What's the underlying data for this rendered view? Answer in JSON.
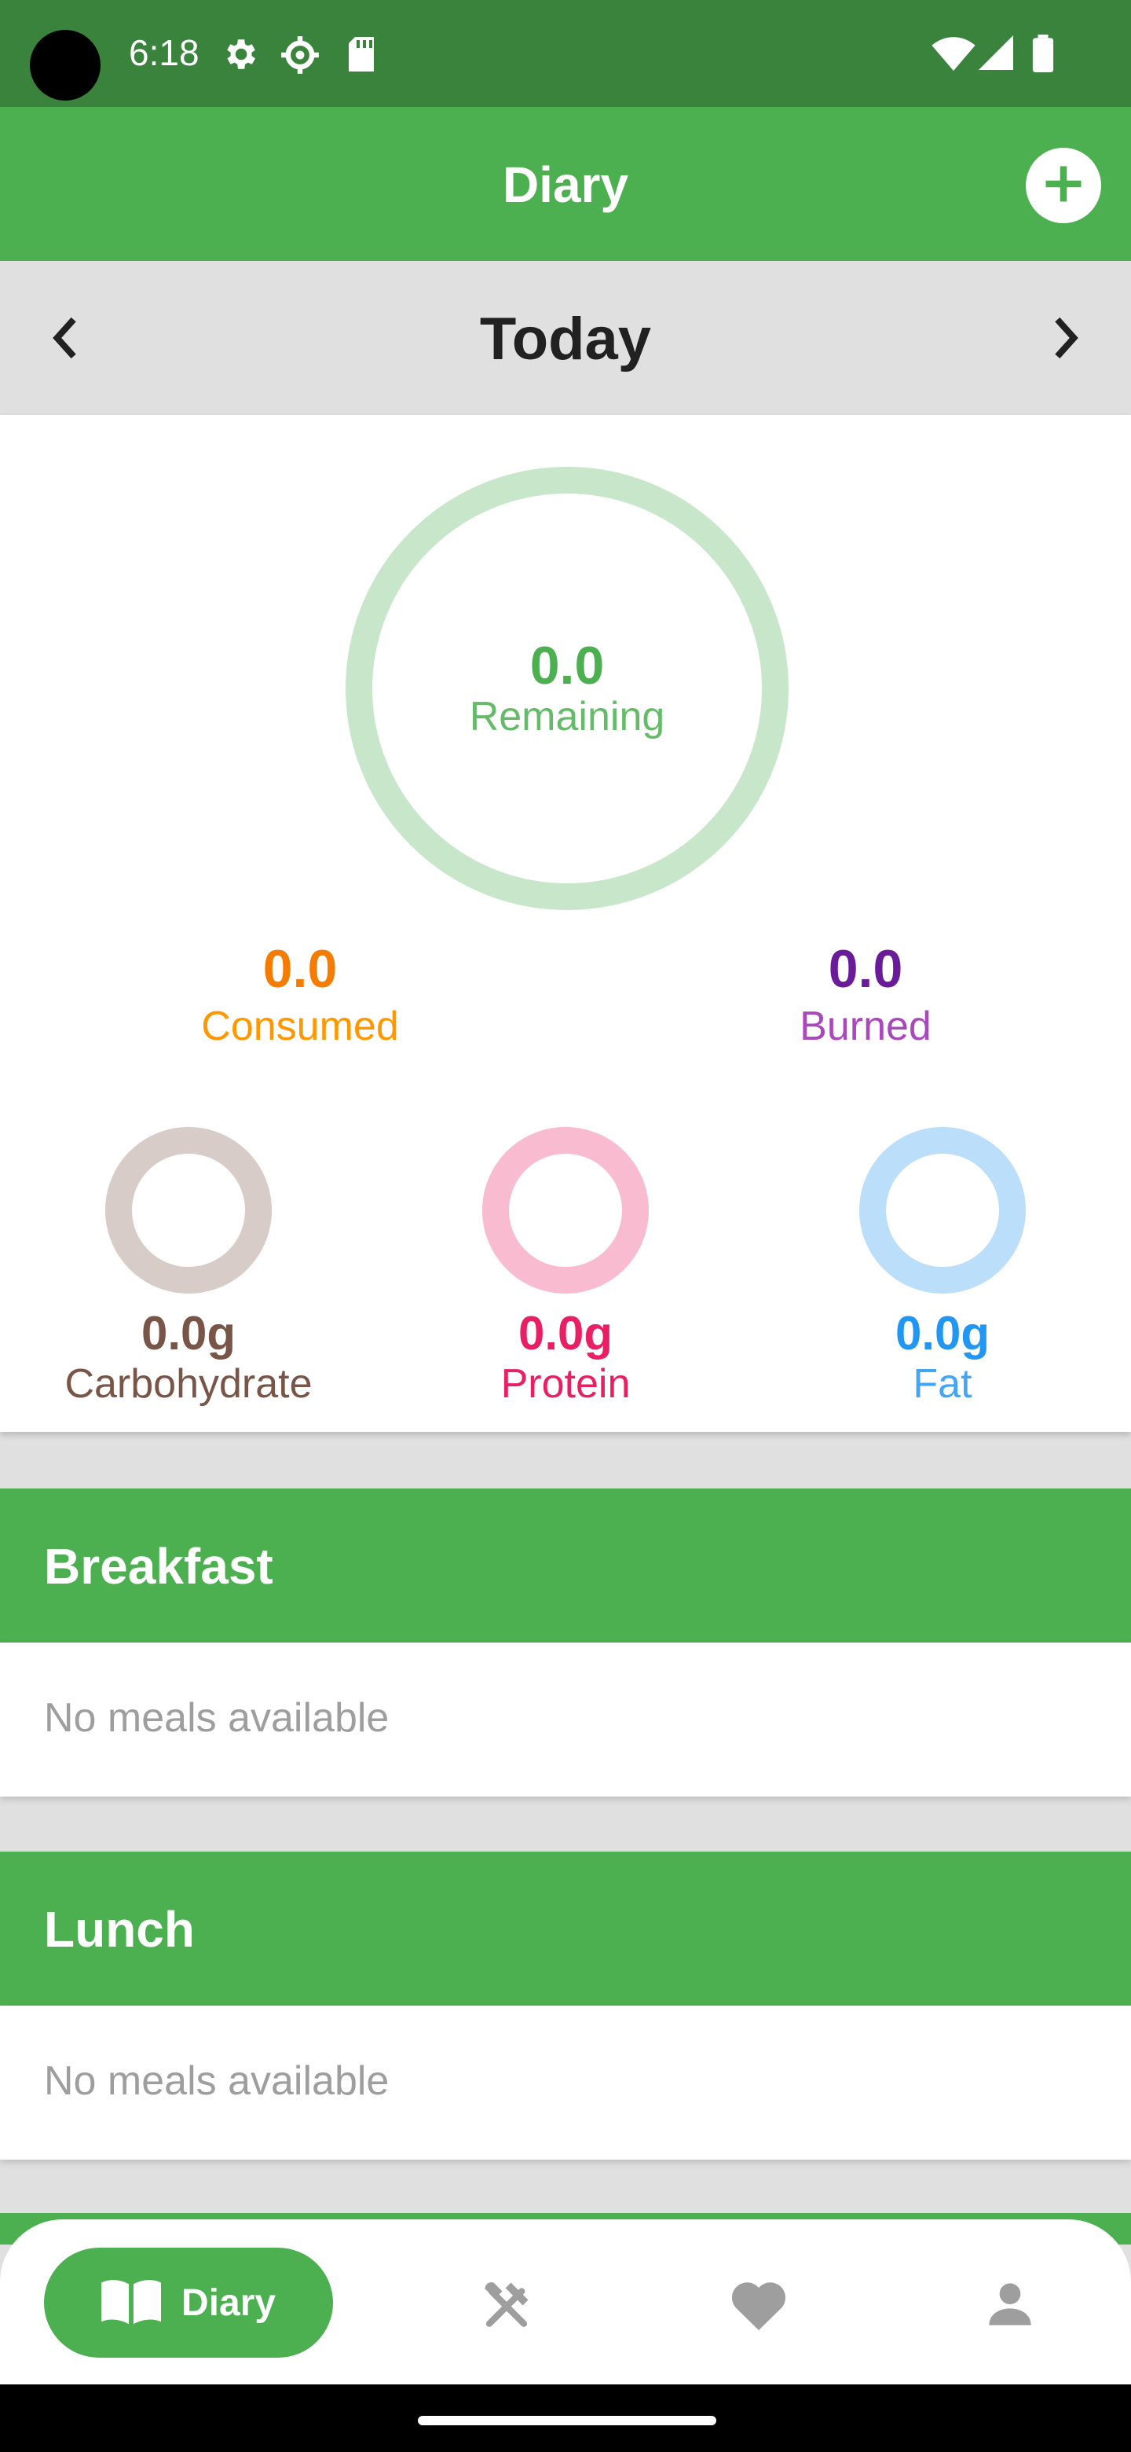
{
  "status_bar": {
    "time": "6:18",
    "icons": [
      "settings-gear-icon",
      "settings-cog-icon",
      "sd-card-icon",
      "wifi-icon",
      "signal-icon",
      "battery-icon"
    ]
  },
  "app_bar": {
    "title": "Diary",
    "add_icon": "plus-circle-icon"
  },
  "date_nav": {
    "label": "Today",
    "prev_icon": "chevron-left-icon",
    "next_icon": "chevron-right-icon"
  },
  "summary": {
    "remaining": {
      "value": "0.0",
      "label": "Remaining"
    },
    "consumed": {
      "value": "0.0",
      "label": "Consumed"
    },
    "burned": {
      "value": "0.0",
      "label": "Burned"
    },
    "macros": [
      {
        "value": "0.0g",
        "label": "Carbohydrate",
        "color": "#795548",
        "ring": "#d7ccc8"
      },
      {
        "value": "0.0g",
        "label": "Protein",
        "color": "#e91e63",
        "ring": "#f8bbd0"
      },
      {
        "value": "0.0g",
        "label": "Fat",
        "color": "#2196f3",
        "ring": "#bbdefb"
      }
    ]
  },
  "meals": [
    {
      "title": "Breakfast",
      "empty_text": "No meals available"
    },
    {
      "title": "Lunch",
      "empty_text": "No meals available"
    }
  ],
  "bottom_nav": {
    "items": [
      {
        "label": "Diary",
        "icon": "book-open-icon",
        "active": true
      },
      {
        "label": "",
        "icon": "fork-knife-icon",
        "active": false
      },
      {
        "label": "",
        "icon": "heart-icon",
        "active": false
      },
      {
        "label": "",
        "icon": "person-icon",
        "active": false
      }
    ]
  },
  "colors": {
    "primary": "#4caf50",
    "status_bar": "#3a833c",
    "consumed": "#f57c00",
    "burned": "#6a1b9a"
  }
}
